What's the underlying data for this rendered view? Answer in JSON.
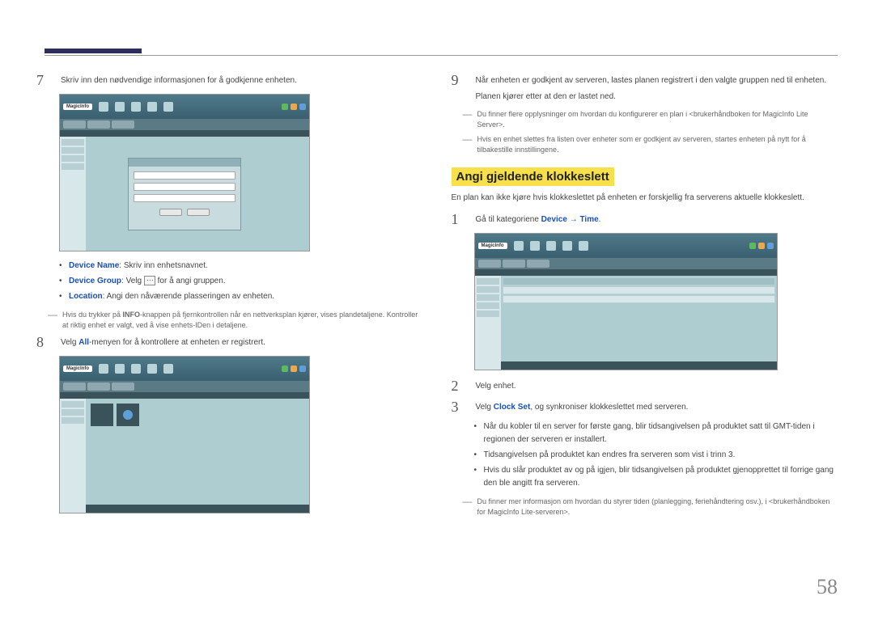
{
  "pageNumber": "58",
  "left": {
    "step7": {
      "num": "7",
      "text": "Skriv inn den nødvendige informasjonen for å godkjenne enheten."
    },
    "bullets": {
      "b1_label": "Device Name",
      "b1_text": ": Skriv inn enhetsnavnet.",
      "b2_label": "Device Group",
      "b2_text_a": ": Velg ",
      "b2_text_b": " for å angi gruppen.",
      "b3_label": "Location",
      "b3_text": ": Angi den nåværende plasseringen av enheten."
    },
    "note1": "Hvis du trykker på ",
    "note1_bold": "INFO",
    "note1_rest": "-knappen på fjernkontrollen når en nettverksplan kjører, vises plandetaljene. Kontroller at riktig enhet er valgt, ved å vise enhets-IDen i detaljene.",
    "step8": {
      "num": "8",
      "text_a": "Velg ",
      "text_blue": "All",
      "text_b": "-menyen for å kontrollere at enheten er registrert."
    }
  },
  "right": {
    "step9": {
      "num": "9",
      "text1": "Når enheten er godkjent av serveren, lastes planen registrert i den valgte gruppen ned til enheten.",
      "text2": "Planen kjører etter at den er lastet ned."
    },
    "note_a": "Du finner flere opplysninger om hvordan du konfigurerer en plan i <brukerhåndboken for MagicInfo Lite Server>.",
    "note_b": "Hvis en enhet slettes fra listen over enheter som er godkjent av serveren, startes enheten på nytt for å tilbakestille innstillingene.",
    "heading": "Angi gjeldende klokkeslett",
    "intro": "En plan kan ikke kjøre hvis klokkeslettet på enheten er forskjellig fra serverens aktuelle klokkeslett.",
    "step1": {
      "num": "1",
      "text_a": "Gå til kategoriene ",
      "text_blue1": "Device",
      "arrow": " → ",
      "text_blue2": "Time",
      "text_b": "."
    },
    "logo": "MagicInfo",
    "step2": {
      "num": "2",
      "text": "Velg enhet."
    },
    "step3": {
      "num": "3",
      "text_a": "Velg ",
      "text_blue": "Clock Set",
      "text_b": ", og synkroniser klokkeslettet med serveren."
    },
    "bullets2": {
      "b1": "Når du kobler til en server for første gang, blir tidsangivelsen på produktet satt til GMT-tiden i regionen der serveren er installert.",
      "b2": "Tidsangivelsen på produktet kan endres fra serveren som vist i trinn 3.",
      "b3": "Hvis du slår produktet av og på igjen, blir tidsangivelsen på produktet gjenopprettet til forrige gang den ble angitt fra serveren."
    },
    "note_c": "Du finner mer informasjon om hvordan du styrer tiden (planlegging, feriehåndtering osv.), i <brukerhåndboken for MagicInfo Lite-serveren>."
  }
}
